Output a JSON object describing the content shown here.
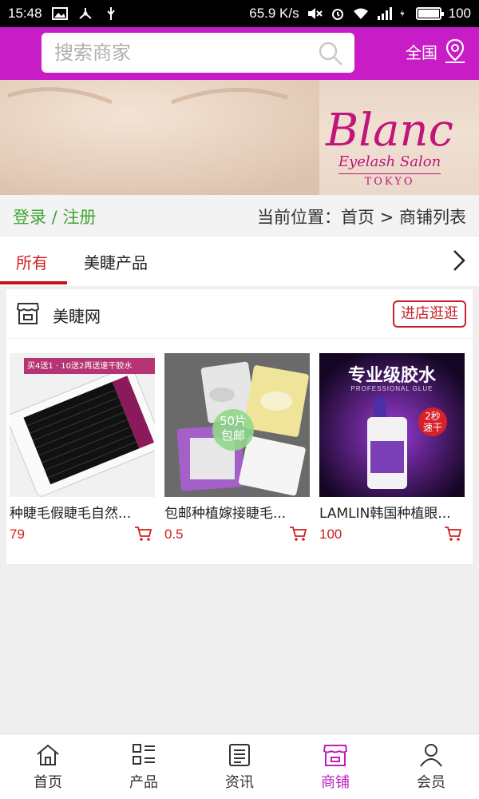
{
  "status_bar": {
    "time": "15:48",
    "speed": "65.9 K/s",
    "battery": "100"
  },
  "header": {
    "search_placeholder": "搜索商家",
    "region": "全国"
  },
  "banner": {
    "brand": "Blanc",
    "sub": "Eyelash Salon",
    "city": "TOKYO"
  },
  "location_bar": {
    "login": "登录",
    "separator": " / ",
    "register": "注册",
    "breadcrumb": "当前位置：首页 > 商铺列表"
  },
  "tabs": [
    {
      "label": "所有",
      "active": true
    },
    {
      "label": "美睫产品",
      "active": false
    }
  ],
  "shop": {
    "name": "美睫网",
    "visit_label": "进店逛逛",
    "products": [
      {
        "title": "种睫毛假睫毛自然...",
        "price": "79",
        "badge": "买4送1 · 10送2再送速干胶水"
      },
      {
        "title": "包邮种植嫁接睫毛...",
        "price": "0.5",
        "badge": "50片包邮"
      },
      {
        "title": "LAMLIN韩国种植眼...",
        "price": "100",
        "headline": "专业级胶水",
        "sub": "PROFESSIONAL GLUE",
        "badge": "2秒速干"
      }
    ]
  },
  "bottom_nav": [
    {
      "label": "首页",
      "icon": "home-icon",
      "active": false
    },
    {
      "label": "产品",
      "icon": "grid-list-icon",
      "active": false
    },
    {
      "label": "资讯",
      "icon": "news-icon",
      "active": false
    },
    {
      "label": "商铺",
      "icon": "store-icon",
      "active": true
    },
    {
      "label": "会员",
      "icon": "user-icon",
      "active": false
    }
  ],
  "colors": {
    "brand": "#c81cc6",
    "accent_red": "#c8212a",
    "price": "#d02020",
    "link_green": "#3fa535"
  }
}
